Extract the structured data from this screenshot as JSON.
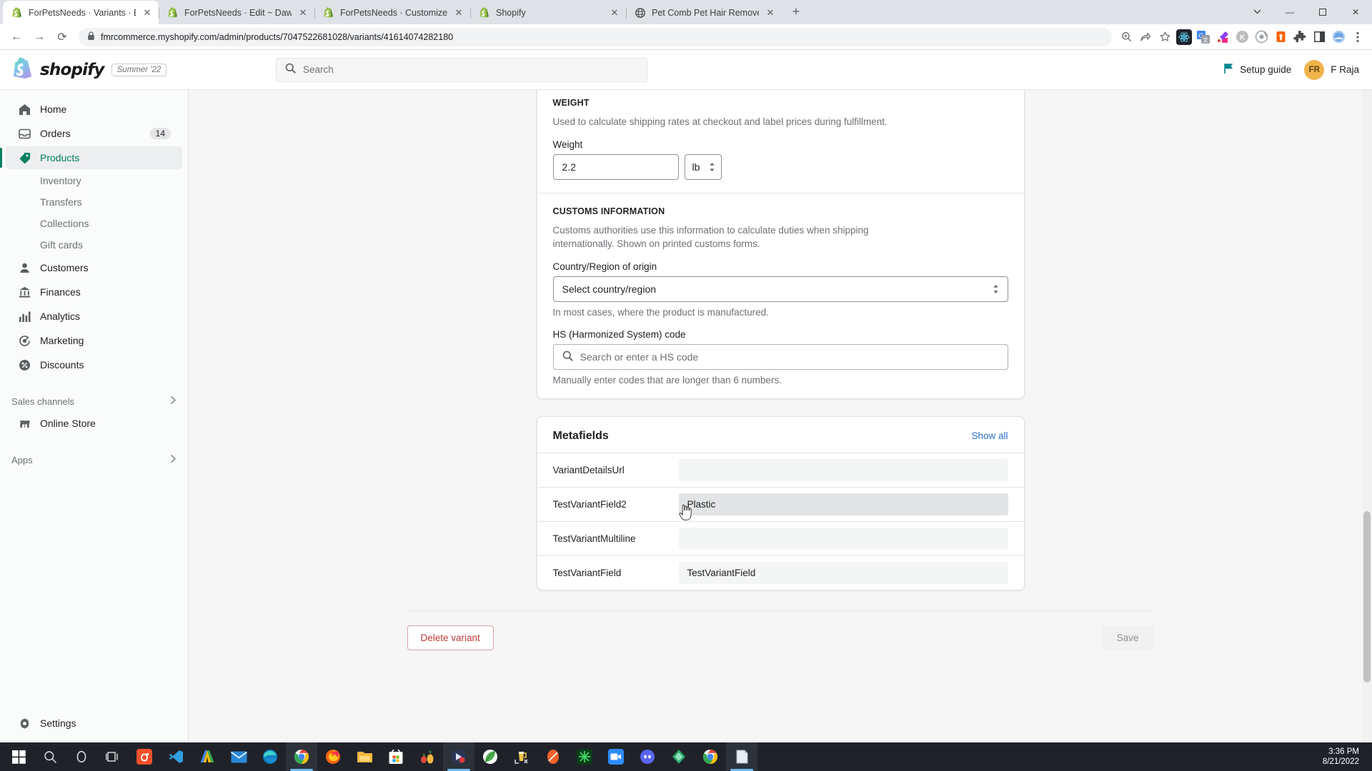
{
  "browser": {
    "tabs": [
      {
        "title": "ForPetsNeeds · Variants · Blue · Sl",
        "favicon": "shopify-favicon",
        "active": true
      },
      {
        "title": "ForPetsNeeds · Edit ~ Dawn - Pro",
        "favicon": "shopify-favicon",
        "active": false
      },
      {
        "title": "ForPetsNeeds · Customize Dawn",
        "favicon": "shopify-favicon",
        "active": false
      },
      {
        "title": "Shopify",
        "favicon": "shopify-favicon",
        "active": false
      },
      {
        "title": "Pet Comb Pet Hair Remover Dog",
        "favicon": "globe-favicon",
        "active": false
      }
    ],
    "new_tab_label": "+",
    "close_label": "✕",
    "window_controls": {
      "minimize": "—",
      "maximize": "▢",
      "close": "✕"
    },
    "nav": {
      "back": "←",
      "forward": "→",
      "reload": "⟳"
    },
    "url": "fmrcommerce.myshopify.com/admin/products/7047522681028/variants/41614074282180",
    "lock_icon": "lock-icon",
    "toolbar_icons": [
      "zoom-icon",
      "share-icon",
      "bookmark-star-icon",
      "react-devtools-icon",
      "google-translate-icon",
      "colorpicker-icon",
      "kami-icon",
      "circle-target-icon",
      "lastpass-icon",
      "extensions-puzzle-icon",
      "window-icon",
      "profile-icon",
      "menu-kebab-icon"
    ]
  },
  "shopify_header": {
    "wordmark": "shopify",
    "badge": "Summer '22",
    "search_placeholder": "Search",
    "search_icon": "search-icon",
    "setup_guide_label": "Setup guide",
    "setup_guide_icon": "flag-icon",
    "avatar_initials": "FR",
    "user_name": "F Raja"
  },
  "sidebar": {
    "items": [
      {
        "label": "Home",
        "icon": "home-icon",
        "badge": null,
        "active": false
      },
      {
        "label": "Orders",
        "icon": "orders-inbox-icon",
        "badge": "14",
        "active": false
      },
      {
        "label": "Products",
        "icon": "products-tag-icon",
        "badge": null,
        "active": true
      }
    ],
    "sub_items": [
      "Inventory",
      "Transfers",
      "Collections",
      "Gift cards"
    ],
    "items2": [
      {
        "label": "Customers",
        "icon": "customer-person-icon"
      },
      {
        "label": "Finances",
        "icon": "finances-bank-icon"
      },
      {
        "label": "Analytics",
        "icon": "analytics-bars-icon"
      },
      {
        "label": "Marketing",
        "icon": "marketing-target-icon"
      },
      {
        "label": "Discounts",
        "icon": "discounts-percent-icon"
      }
    ],
    "sales_channels_label": "Sales channels",
    "online_store_label": "Online Store",
    "online_store_icon": "storefront-icon",
    "apps_label": "Apps",
    "chevron_icon": "chevron-right-icon",
    "settings_label": "Settings",
    "settings_icon": "gear-icon"
  },
  "main": {
    "weight": {
      "section_title": "WEIGHT",
      "description": "Used to calculate shipping rates at checkout and label prices during fulfillment.",
      "field_label": "Weight",
      "value": "2.2",
      "unit": "lb"
    },
    "customs": {
      "section_title": "CUSTOMS INFORMATION",
      "description": "Customs authorities use this information to calculate duties when shipping internationally. Shown on printed customs forms.",
      "country_label": "Country/Region of origin",
      "country_value": "Select country/region",
      "country_help": "In most cases, where the product is manufactured.",
      "hs_label": "HS (Harmonized System) code",
      "hs_placeholder": "Search or enter a HS code",
      "hs_search_icon": "search-icon",
      "hs_help": "Manually enter codes that are longer than 6 numbers."
    },
    "metafields": {
      "title": "Metafields",
      "show_all_label": "Show all",
      "rows": [
        {
          "key": "VariantDetailsUrl",
          "value": "",
          "hovered": false
        },
        {
          "key": "TestVariantField2",
          "value": "Plastic",
          "hovered": true
        },
        {
          "key": "TestVariantMultiline",
          "value": "",
          "hovered": false
        },
        {
          "key": "TestVariantField",
          "value": "TestVariantField",
          "hovered": false
        }
      ]
    },
    "actions": {
      "delete_label": "Delete variant",
      "save_label": "Save"
    }
  },
  "taskbar": {
    "icons": [
      "windows-start-icon",
      "search-icon",
      "cortana-icon",
      "task-view-icon",
      "app-orange-o-icon",
      "vscode-icon",
      "google-ads-icon",
      "mail-icon",
      "edge-icon",
      "chrome-icon",
      "firefox-icon",
      "file-explorer-icon",
      "microsoft-store-icon",
      "pineapple-icon",
      "recording-icon",
      "leaf-icon",
      "beer-measure-icon",
      "orange-oval-icon",
      "green-star-icon",
      "zoom-video-icon",
      "discord-icon",
      "diamond-icon",
      "chrome2-icon",
      "notes-icon"
    ],
    "time": "3:36 PM",
    "date": "8/21/2022"
  },
  "colors": {
    "shopify_green": "#008060",
    "link_blue": "#2c6ecb",
    "danger_red": "#bf3c3c",
    "avatar_bg": "#f1b44c"
  }
}
